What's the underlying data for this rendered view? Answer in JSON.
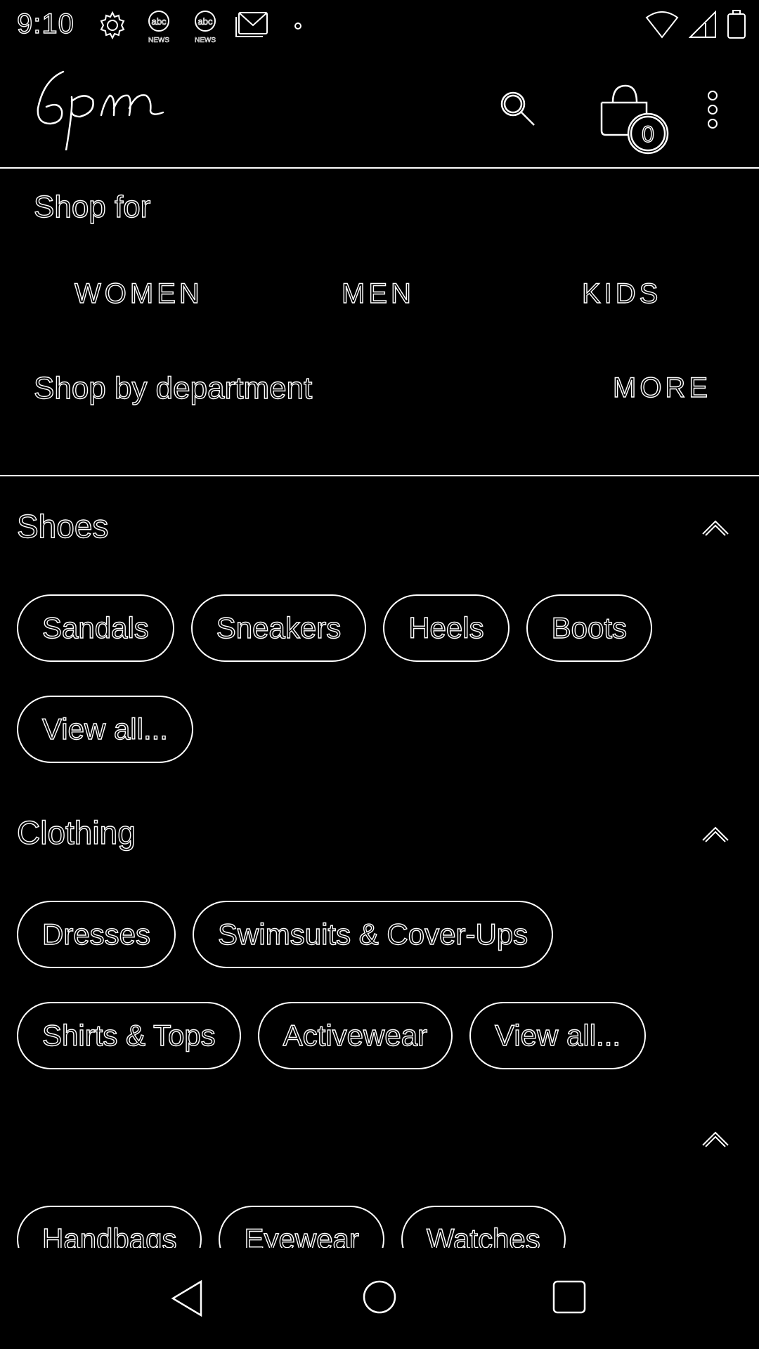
{
  "status_bar": {
    "time": "9:10",
    "icons": [
      "settings-gear-icon",
      "abc-news-icon",
      "abc-news-icon",
      "gmail-icon",
      "dot-icon"
    ],
    "badge_text": "NEWS",
    "right_icons": [
      "wifi-icon",
      "signal-icon",
      "battery-icon"
    ]
  },
  "app_bar": {
    "logo_text": "6pm",
    "cart_count": "0",
    "icons": [
      "search-icon",
      "shopping-bag-icon",
      "more-vert-icon"
    ]
  },
  "shop_for": {
    "title": "Shop for",
    "options": [
      "WOMEN",
      "MEN",
      "KIDS"
    ]
  },
  "department": {
    "title": "Shop by department",
    "more_label": "MORE"
  },
  "categories": [
    {
      "title": "Shoes",
      "rows": [
        [
          "Sandals",
          "Sneakers",
          "Heels",
          "Boots"
        ],
        [
          "View all..."
        ]
      ]
    },
    {
      "title": "Clothing",
      "rows": [
        [
          "Dresses",
          "Swimsuits & Cover-Ups"
        ],
        [
          "Shirts & Tops",
          "Activewear",
          "View all..."
        ]
      ]
    },
    {
      "title": "",
      "rows": [
        [
          "Handbags",
          "Eyewear",
          "Watches"
        ]
      ]
    }
  ],
  "nav_bar": {
    "icons": [
      "back-icon",
      "home-icon",
      "recents-icon"
    ]
  }
}
